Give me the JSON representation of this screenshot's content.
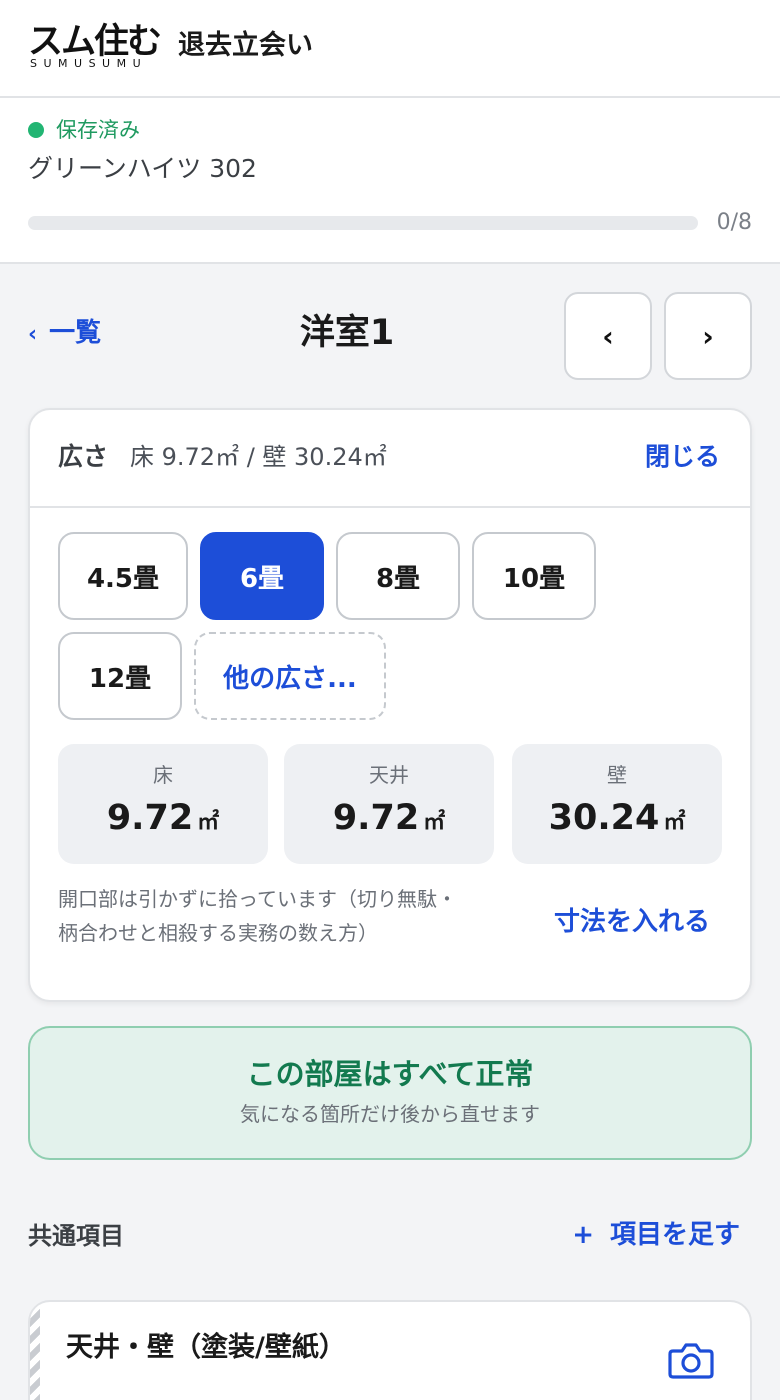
{
  "header": {
    "logo_text": "スム住む",
    "logo_sub": "SUMUSUMU",
    "title": "退去立会い"
  },
  "status": {
    "save_label": "保存済み",
    "property_name": "グリーンハイツ 302",
    "progress_count": "0/8",
    "progress_fraction": 0
  },
  "nav": {
    "back_label": "一覧",
    "room_title": "洋室1",
    "prev_glyph": "‹",
    "next_glyph": "›"
  },
  "area_card": {
    "label": "広さ",
    "summary": "床 9.72㎡  /  壁 30.24㎡",
    "close_label": "閉じる",
    "chips": [
      "4.5畳",
      "6畳",
      "8畳",
      "10畳",
      "12畳"
    ],
    "selected_chip": "6畳",
    "other_label": "他の広さ...",
    "floor": {
      "label": "床",
      "value": "9.72",
      "unit": "㎡"
    },
    "ceiling": {
      "label": "天井",
      "value": "9.72",
      "unit": "㎡"
    },
    "wall": {
      "label": "壁",
      "value": "30.24",
      "unit": "㎡"
    },
    "note_line1": "開口部は引かずに拾っています（切り無駄・",
    "note_line2": "柄合わせと相殺する実務の数え方）",
    "measure_label": "寸法を入れる"
  },
  "status_box": {
    "title": "この部屋はすべて正常",
    "subtitle": "気になる箇所だけ後から直せます"
  },
  "common_items": {
    "section_title": "共通項目",
    "add_label": "項目を足す",
    "add_glyph": "+",
    "items": [
      {
        "title": "天井・壁（塗装/壁紙）",
        "icon": "camera-icon"
      }
    ]
  },
  "colors": {
    "accent": "#1d4ed8",
    "saved_green": "#22b573",
    "normal_green": "#137a4f",
    "normal_bg": "#e3f2ec"
  }
}
